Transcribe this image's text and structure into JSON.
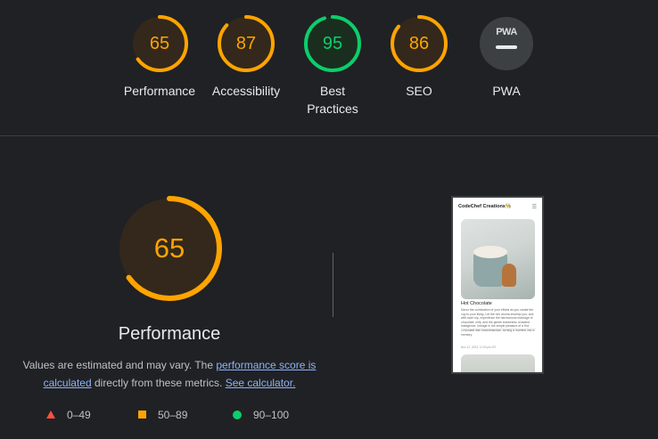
{
  "gauges": [
    {
      "name": "performance",
      "score": "65",
      "label": "Performance",
      "color": "#ffa400",
      "fill": "#33281b",
      "value": 0.65
    },
    {
      "name": "accessibility",
      "score": "87",
      "label": "Accessibility",
      "color": "#ffa400",
      "fill": "#33281b",
      "value": 0.87
    },
    {
      "name": "best-practices",
      "score": "95",
      "label": "Best Practices",
      "color": "#0cce6b",
      "fill": "#1a2e1f",
      "value": 0.95
    },
    {
      "name": "seo",
      "score": "86",
      "label": "SEO",
      "color": "#ffa400",
      "fill": "#33281b",
      "value": 0.86
    },
    {
      "name": "pwa",
      "score": "",
      "label": "PWA",
      "badge": "PWA",
      "color": "#5f6368",
      "fill": "#3c4043",
      "value": 0
    }
  ],
  "main": {
    "score": "65",
    "value": 0.65,
    "title": "Performance",
    "color": "#ffa400",
    "fill": "#33281b",
    "desc_before": "Values are estimated and may vary. The ",
    "link_score": "performance score is calculated",
    "desc_middle": " directly from these metrics. ",
    "link_calc": "See calculator."
  },
  "legend": [
    {
      "range": "0–49",
      "shape": "triangle",
      "color": "#ff4e42"
    },
    {
      "range": "50–89",
      "shape": "square",
      "color": "#ffa400"
    },
    {
      "range": "90–100",
      "shape": "circle",
      "color": "#0cce6b"
    }
  ],
  "screenshot": {
    "brand": "CodeChef Creations👨‍🍳",
    "post_title": "Hot Chocolate",
    "post_text": "Savor the culmination of your efforts as you create the cup to your liking. Let the rich aroma envelop you, and with each sip, experience the harmonious marriage of chocolate, milk, and the gentle sweetness of added indulgence. Indulge in the simple pleasure of a Hot Chocolate with marshmallows, turning a moment into a memory.",
    "post_date": "Nov 12, 2023, 11:30 pm IST"
  }
}
